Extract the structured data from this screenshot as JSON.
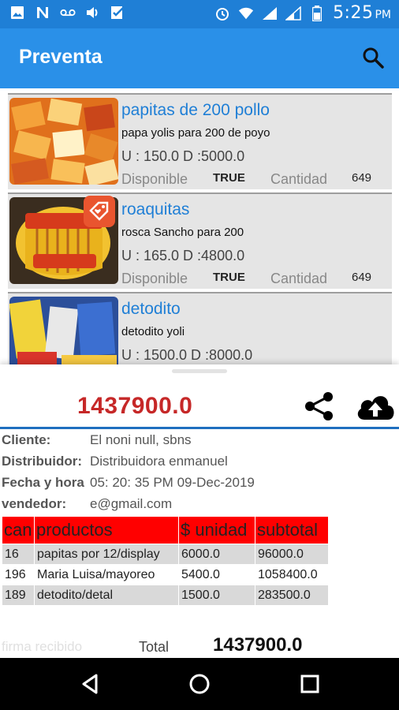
{
  "status_bar": {
    "time": "5:25",
    "ampm": "PM"
  },
  "app_bar": {
    "title": "Preventa"
  },
  "products": [
    {
      "name": "papitas de 200 pollo",
      "description": "papa yolis para 200 de poyo",
      "price_line": "U : 150.0  D :5000.0",
      "available_label": "Disponible",
      "available_value": "TRUE",
      "quantity_label": "Cantidad",
      "quantity": "649"
    },
    {
      "name": "roaquitas",
      "description": "rosca Sancho para 200",
      "price_line": "U : 165.0  D :4800.0",
      "available_label": "Disponible",
      "available_value": "TRUE",
      "quantity_label": "Cantidad",
      "quantity": "649"
    },
    {
      "name": "detodito",
      "description": "detodito yoli",
      "price_line": "U : 1500.0  D :8000.0"
    }
  ],
  "order": {
    "total": "1437900.0",
    "cliente_label": "Cliente:",
    "cliente": "El noni null, sbns",
    "distribuidor_label": "Distribuidor:",
    "distribuidor": "Distribuidora enmanuel",
    "fecha_label": "Fecha y hora",
    "fecha": "05: 20: 35 PM 09-Dec-2019",
    "vendedor_label": "vendedor:",
    "vendedor": "e@gmail.com",
    "columns": [
      "can",
      "productos",
      "$ unidad",
      "subtotal"
    ],
    "rows": [
      [
        "16",
        "papitas por 12/display",
        "6000.0",
        "96000.0"
      ],
      [
        "196",
        "Maria Luisa/mayoreo",
        "5400.0",
        "1058400.0"
      ],
      [
        "189",
        "detodito/detal",
        "1500.0",
        "283500.0"
      ]
    ],
    "firma_label": "firma recibido",
    "total_label": "Total",
    "total_value": "1437900.0"
  },
  "colors": {
    "primary": "#2a90e8",
    "status": "#1f7fd6",
    "accent_red": "#c62828",
    "header_red": "#ff0000"
  }
}
